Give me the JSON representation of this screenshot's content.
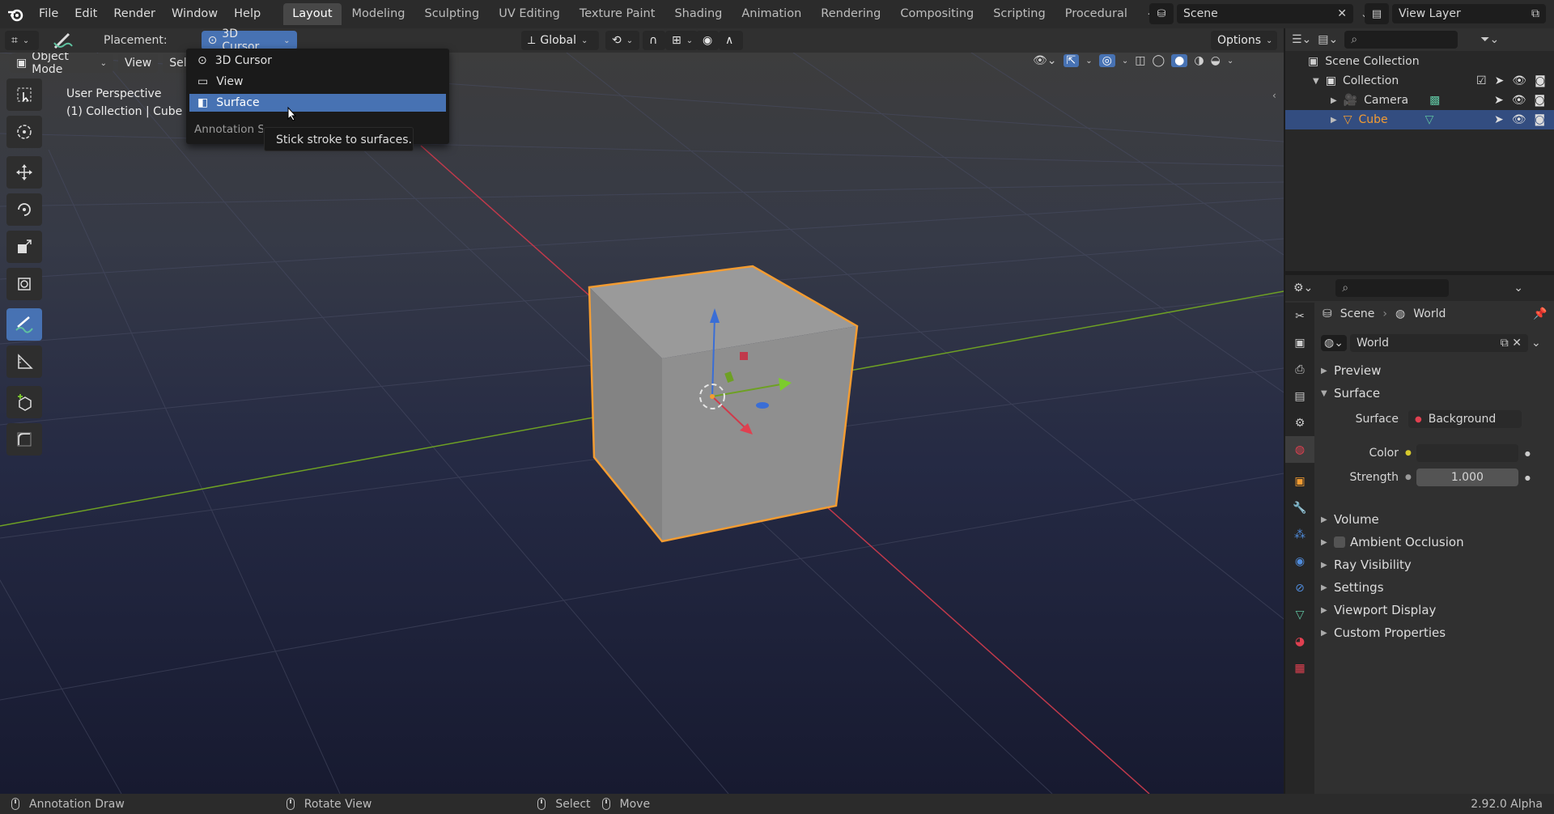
{
  "top_menu": [
    "File",
    "Edit",
    "Render",
    "Window",
    "Help"
  ],
  "workspaces": [
    "Layout",
    "Modeling",
    "Sculpting",
    "UV Editing",
    "Texture Paint",
    "Shading",
    "Animation",
    "Rendering",
    "Compositing",
    "Scripting",
    "Procedural"
  ],
  "active_workspace": "Layout",
  "scene_name": "Scene",
  "view_layer_name": "View Layer",
  "tool_header": {
    "placement_label": "Placement:",
    "placement_value": "3D Cursor",
    "orientation_value": "Global",
    "options_label": "Options"
  },
  "viewport_header": {
    "mode": "Object Mode",
    "view": "View",
    "select_truncated": "Sele"
  },
  "viewport_overlay": {
    "perspective": "User Perspective",
    "collection_info": "(1) Collection | Cube"
  },
  "placement_dropdown": {
    "options": [
      "3D Cursor",
      "View",
      "Surface"
    ],
    "highlighted": "Surface",
    "partial_label": "Annotation St",
    "tooltip": "Stick stroke to surfaces."
  },
  "outliner": {
    "root": "Scene Collection",
    "collection": "Collection",
    "items": [
      {
        "label": "Camera"
      },
      {
        "label": "Cube"
      }
    ]
  },
  "properties": {
    "breadcrumb_scene": "Scene",
    "breadcrumb_world": "World",
    "world_name": "World",
    "panels": {
      "preview": "Preview",
      "surface": "Surface",
      "volume": "Volume",
      "ambient_occlusion": "Ambient Occlusion",
      "ray_visibility": "Ray Visibility",
      "settings": "Settings",
      "viewport_display": "Viewport Display",
      "custom_properties": "Custom Properties"
    },
    "surface_label": "Surface",
    "surface_value": "Background",
    "color_label": "Color",
    "strength_label": "Strength",
    "strength_value": "1.000"
  },
  "status_bar": {
    "left": "Annotation Draw",
    "middle": "Rotate View",
    "select": "Select",
    "move": "Move",
    "version": "2.92.0 Alpha"
  },
  "colors": {
    "accent": "#4772b3",
    "selection_outline": "#f39c32",
    "x_axis": "#c0394b",
    "y_axis": "#6ea024"
  }
}
